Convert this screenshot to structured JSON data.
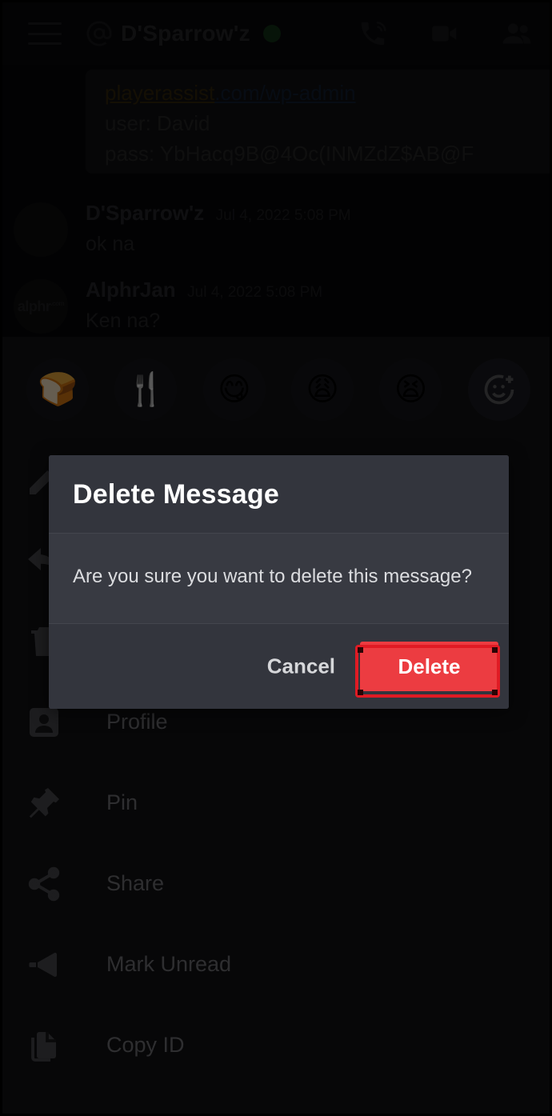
{
  "header": {
    "menu_icon": "hamburger-icon",
    "at_icon": "at-icon",
    "title": "D'Sparrow'z",
    "status": "online",
    "actions": [
      {
        "icon": "voice-call-icon",
        "label": "Start Voice Call"
      },
      {
        "icon": "video-call-icon",
        "label": "Start Video Call"
      },
      {
        "icon": "members-icon",
        "label": "Members"
      }
    ]
  },
  "chat": {
    "code_block": {
      "link_part1": "playerassist",
      "link_part2": ".com/wp-admin",
      "line_user": "user: David",
      "line_pass": "pass: YbHacq9B@4Oc(INMZdZ$AB@F"
    },
    "messages": [
      {
        "author": "D'Sparrow'z",
        "timestamp": "Jul 4, 2022 5:08 PM",
        "body": "ok na",
        "avatar": "avatar-sparrow"
      },
      {
        "author": "AlphrJan",
        "timestamp": "Jul 4, 2022 5:08 PM",
        "body": "Ken na?",
        "avatar": "avatar-alphr",
        "avatar_text": "alphr",
        "avatar_text_sup": ".com"
      }
    ]
  },
  "sheet": {
    "emoji_row": [
      {
        "name": "bread-emoji",
        "glyph": "🍞"
      },
      {
        "name": "fork-and-knife-emoji",
        "glyph": "🍴"
      },
      {
        "name": "yum-face-emoji",
        "glyph": "😋"
      },
      {
        "name": "weary-face-emoji",
        "glyph": "😩"
      },
      {
        "name": "tired-face-emoji",
        "glyph": "😫"
      },
      {
        "name": "add-reaction-icon",
        "glyph": ""
      }
    ],
    "menu_items": [
      {
        "icon": "pencil-icon",
        "label": "Edit"
      },
      {
        "icon": "reply-arrow-icon",
        "label": "Reply"
      },
      {
        "icon": "trash-icon",
        "label": "Delete"
      },
      {
        "icon": "profile-icon",
        "label": "Profile"
      },
      {
        "icon": "pin-icon",
        "label": "Pin"
      },
      {
        "icon": "share-icon",
        "label": "Share"
      },
      {
        "icon": "mark-unread-icon",
        "label": "Mark Unread"
      },
      {
        "icon": "copy-id-icon",
        "label": "Copy ID"
      }
    ]
  },
  "dialog": {
    "title": "Delete Message",
    "message": "Are you sure you want to delete this message?",
    "cancel_label": "Cancel",
    "delete_label": "Delete"
  },
  "colors": {
    "danger": "#ec3c41",
    "annotation": "#e01b24",
    "dialog_bg": "#383a42",
    "dialog_head_bg": "#33353d",
    "sheet_bg": "#141417",
    "online_green": "#3ba55d"
  }
}
